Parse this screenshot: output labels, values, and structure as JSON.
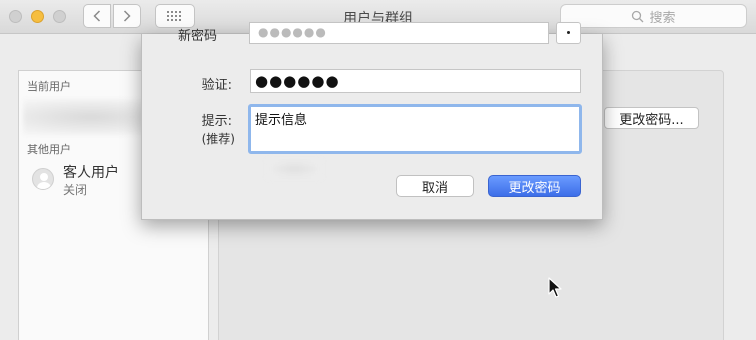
{
  "window": {
    "title": "用户与群组",
    "search_placeholder": "搜索"
  },
  "sidebar": {
    "current_users_heading": "当前用户",
    "other_users_heading": "其他用户",
    "guest": {
      "name": "客人用户",
      "status": "关闭"
    }
  },
  "main": {
    "change_password_button": "更改密码..."
  },
  "dialog": {
    "new_password_label": "新密码",
    "verify_label": "验证:",
    "verify_value": "●●●●●●",
    "hint_label": "提示:",
    "hint_sublabel": "(推荐)",
    "hint_value": "提示信息",
    "cancel_button": "取消",
    "confirm_button": "更改密码"
  },
  "colors": {
    "primary_button": "#3d6ee8",
    "focus_ring": "#8fb7ec",
    "minimize_light": "#f6be40"
  }
}
